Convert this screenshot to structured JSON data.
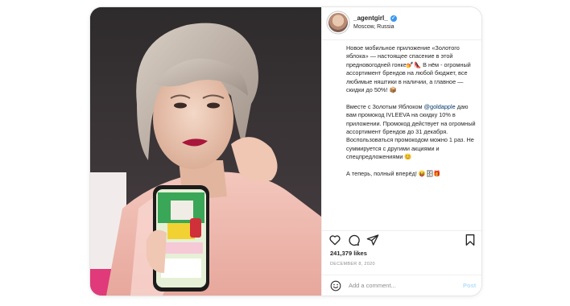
{
  "post": {
    "username": "_agentgirl_",
    "location": "Moscow, Russia",
    "caption": {
      "p1": "Новое мобильное приложение «Золотого яблока» — настоящее спасение в этой предновогодней гонке💅👠 В нём - огромный ассортимент брендов на любой бюджет, все любимые няштики в наличии, а главное — скидки до 50%! 📦",
      "p2_before": "Вместе с Золотым Яблоком ",
      "p2_mention": "@goldapple",
      "p2_after": " даю вам промокод IVLEEVA на скидку 10% в приложении. Промокод действует на огромный ассортимент брендов до 31 декабря. Воспользоваться промокодом можно 1 раз. Не суммируется с другими акциями и спецпредложениями 😊",
      "p3": "А теперь, полный вперёд! 😝🗄🎁"
    },
    "likes": "241,379 likes",
    "date": "DECEMBER 8, 2020",
    "comment_placeholder": "Add a comment...",
    "post_button": "Post"
  },
  "icons": {
    "verified": "verified-badge-icon",
    "like": "heart-icon",
    "comment": "comment-icon",
    "share": "paper-plane-icon",
    "save": "bookmark-icon",
    "emoji": "emoji-icon"
  },
  "colors": {
    "verified": "#3897f0",
    "mention": "#00376b",
    "post_button": "#b2dffc",
    "secondary_text": "#8e8e8e"
  }
}
